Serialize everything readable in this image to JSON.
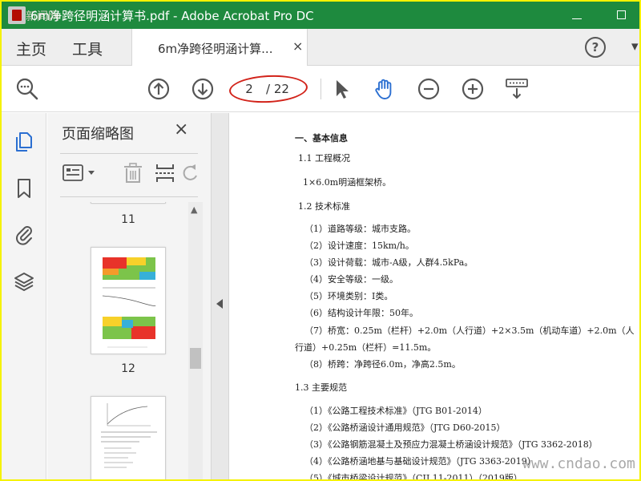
{
  "window": {
    "title": "6m净跨径明涵计算书.pdf - Adobe Acrobat Pro DC",
    "minimize_label": "minimize",
    "maximize_label": "maximize"
  },
  "nav": {
    "home": "主页",
    "tools": "工具",
    "doc_tab": "6m净跨径明涵计算...",
    "doc_tab_close": "×",
    "help": "?"
  },
  "toolbar": {
    "current_page": "2",
    "total_pages": "/ 22"
  },
  "panel": {
    "title": "页面缩略图",
    "close": "×",
    "thumbnails": [
      {
        "page": "11"
      },
      {
        "page": "12"
      }
    ]
  },
  "document": {
    "lines": [
      {
        "text": "一、基本信息",
        "heading": true
      },
      {
        "text": "1.1 工程概况",
        "heading": false
      },
      {
        "text": "1×6.0m明涵框架桥。",
        "heading": false
      },
      {
        "text": "1.2 技术标准",
        "heading": false
      },
      {
        "text": "（1）道路等级：城市支路。",
        "heading": false
      },
      {
        "text": "（2）设计速度：15km/h。",
        "heading": false
      },
      {
        "text": "（3）设计荷载：城市-A级，人群4.5kPa。",
        "heading": false
      },
      {
        "text": "（4）安全等级：一级。",
        "heading": false
      },
      {
        "text": "（5）环境类别：Ⅰ类。",
        "heading": false
      },
      {
        "text": "（6）结构设计年限：50年。",
        "heading": false
      },
      {
        "text": "（7）桥宽：0.25m（栏杆）+2.0m（人行道）+2×3.5m（机动车道）+2.0m（人",
        "heading": false
      },
      {
        "text": "行道）+0.25m（栏杆）=11.5m。",
        "heading": false
      },
      {
        "text": "（8）桥跨：净跨径6.0m，净高2.5m。",
        "heading": false
      },
      {
        "text": "1.3 主要规范",
        "heading": false
      },
      {
        "text": "（1）《公路工程技术标准》（JTG B01-2014）",
        "heading": false
      },
      {
        "text": "（2）《公路桥涵设计通用规范》（JTG D60-2015）",
        "heading": false
      },
      {
        "text": "（3）《公路钢筋混凝土及预应力混凝土桥涵设计规范》（JTG 3362-2018）",
        "heading": false
      },
      {
        "text": "（4）《公路桥涵地基与基础设计规范》（JTG 3363-2019）",
        "heading": false
      },
      {
        "text": "（5）《城市桥梁设计规范》（CJJ 11-2011）（2019版）",
        "heading": false
      }
    ]
  },
  "watermark": "www.cndao.com",
  "corner_mark": "新闻网",
  "colors": {
    "titlebar": "#1e8a3e",
    "frame": "#f5f200",
    "annotation_ring": "#d2231a",
    "hand_tool_active": "#2b6fd1"
  }
}
